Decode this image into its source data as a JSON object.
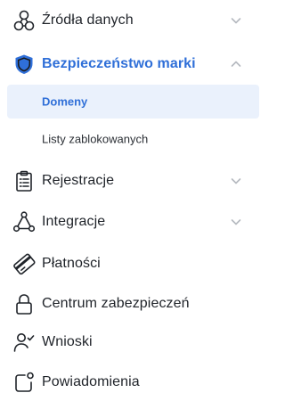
{
  "sidebar": {
    "items": [
      {
        "label": "Źródła danych",
        "icon": "data-sources-icon",
        "expanded": false
      },
      {
        "label": "Bezpieczeństwo marki",
        "icon": "shield-icon",
        "expanded": true,
        "active": true,
        "children": [
          {
            "label": "Domeny",
            "selected": true
          },
          {
            "label": "Listy zablokowanych",
            "selected": false
          }
        ]
      },
      {
        "label": "Rejestracje",
        "icon": "clipboard-icon",
        "expanded": false
      },
      {
        "label": "Integracje",
        "icon": "integrations-icon",
        "expanded": false
      },
      {
        "label": "Płatności",
        "icon": "credit-card-icon"
      },
      {
        "label": "Centrum zabezpieczeń",
        "icon": "lock-icon"
      },
      {
        "label": "Wnioski",
        "icon": "user-check-icon"
      },
      {
        "label": "Powiadomienia",
        "icon": "notification-icon"
      }
    ]
  },
  "colors": {
    "accent": "#2f6fd8",
    "selected_bg": "#eaf1fc",
    "text": "#1f2329",
    "chevron": "#b5b9bf"
  }
}
